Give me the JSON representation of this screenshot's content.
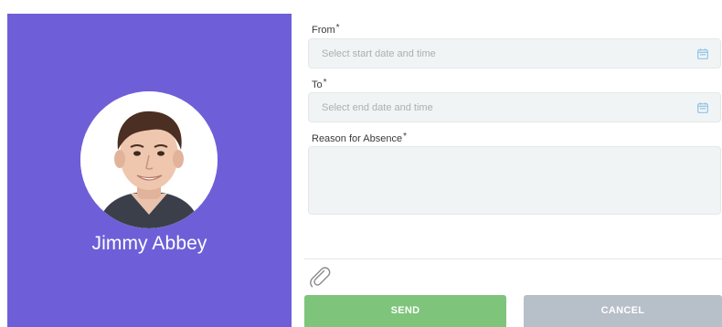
{
  "profile": {
    "name": "Jimmy Abbey",
    "panel_color": "#6e5fd8"
  },
  "form": {
    "from": {
      "label": "From",
      "required_mark": "*",
      "placeholder": "Select start date and time",
      "icon": "calendar-icon"
    },
    "to": {
      "label": "To",
      "required_mark": "*",
      "placeholder": "Select end date and time",
      "icon": "calendar-icon"
    },
    "reason": {
      "label": "Reason for Absence",
      "required_mark": "*",
      "value": ""
    },
    "attachment_icon": "paperclip-icon"
  },
  "actions": {
    "send_label": "SEND",
    "cancel_label": "CANCEL",
    "send_color": "#7ec47b",
    "cancel_color": "#b7bfc9"
  }
}
